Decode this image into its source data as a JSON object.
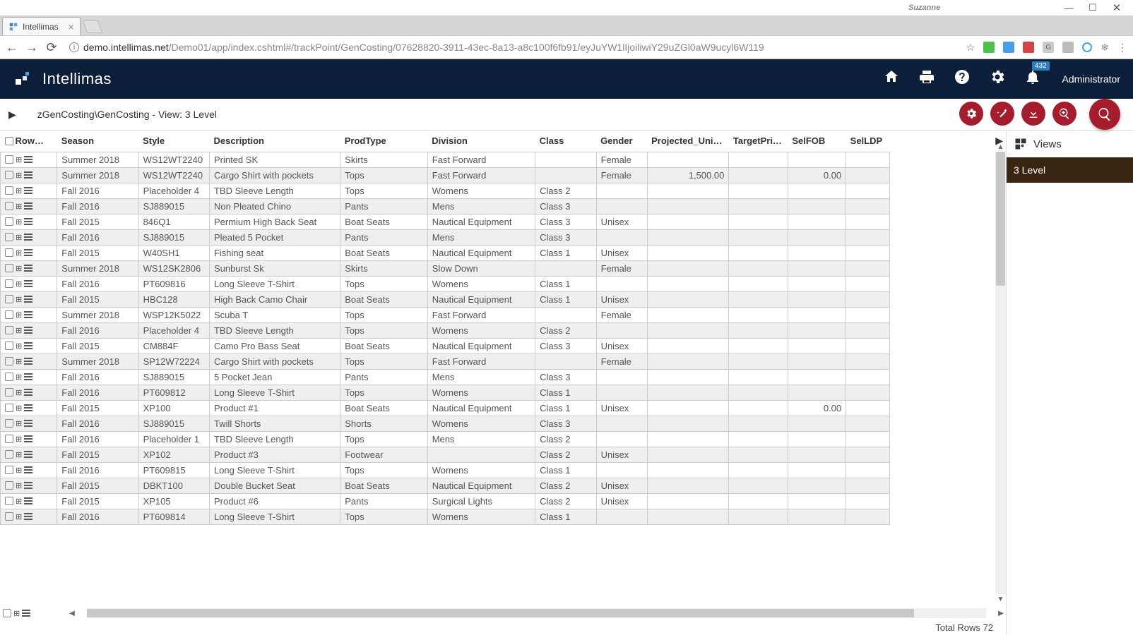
{
  "window": {
    "user": "Suzanne",
    "tab_title": "Intellimas",
    "url_host": "demo.intellimas.net",
    "url_path": "/Demo01/app/index.cshtml#/trackPoint/GenCosting/07628820-3911-43ec-8a13-a8c100f6fb91/eyJuYW1lIjoiliwiY29uZGl0aW9ucyl6W119"
  },
  "header": {
    "brand": "Intellimas",
    "notification_count": "432",
    "user_role": "Administrator"
  },
  "breadcrumb": {
    "text": "zGenCosting\\GenCosting - View: 3 Level"
  },
  "views_panel": {
    "title": "Views",
    "items": [
      "3 Level"
    ]
  },
  "grid": {
    "footer": "Total Rows 72",
    "columns": {
      "row": "Row…",
      "season": "Season",
      "style": "Style",
      "description": "Description",
      "prodtype": "ProdType",
      "division": "Division",
      "class": "Class",
      "gender": "Gender",
      "projected": "Projected_Uni…",
      "target": "TargetPri…",
      "selfob": "SelFOB",
      "selldp": "SelLDP"
    },
    "rows": [
      {
        "season": "Summer 2018",
        "style": "WS12WT2240",
        "description": "Printed SK",
        "prodtype": "Skirts",
        "division": "Fast Forward",
        "class": "",
        "gender": "Female",
        "projected": "",
        "target": "",
        "selfob": "",
        "selldp": ""
      },
      {
        "season": "Summer 2018",
        "style": "WS12WT2240",
        "description": "Cargo Shirt with pockets",
        "prodtype": "Tops",
        "division": "Fast Forward",
        "class": "",
        "gender": "Female",
        "projected": "1,500.00",
        "target": "",
        "selfob": "0.00",
        "selldp": ""
      },
      {
        "season": "Fall 2016",
        "style": "Placeholder 4",
        "description": "TBD Sleeve Length",
        "prodtype": "Tops",
        "division": "Womens",
        "class": "Class 2",
        "gender": "",
        "projected": "",
        "target": "",
        "selfob": "",
        "selldp": ""
      },
      {
        "season": "Fall 2016",
        "style": "SJ889015",
        "description": "Non Pleated Chino",
        "prodtype": "Pants",
        "division": "Mens",
        "class": "Class 3",
        "gender": "",
        "projected": "",
        "target": "",
        "selfob": "",
        "selldp": ""
      },
      {
        "season": "Fall 2015",
        "style": "846Q1",
        "description": "Permium High Back Seat",
        "prodtype": "Boat Seats",
        "division": "Nautical Equipment",
        "class": "Class 3",
        "gender": "Unisex",
        "projected": "",
        "target": "",
        "selfob": "",
        "selldp": ""
      },
      {
        "season": "Fall 2016",
        "style": "SJ889015",
        "description": "Pleated 5 Pocket",
        "prodtype": "Pants",
        "division": "Mens",
        "class": "Class 3",
        "gender": "",
        "projected": "",
        "target": "",
        "selfob": "",
        "selldp": ""
      },
      {
        "season": "Fall 2015",
        "style": "W40SH1",
        "description": "Fishing seat",
        "prodtype": "Boat Seats",
        "division": "Nautical Equipment",
        "class": "Class 1",
        "gender": "Unisex",
        "projected": "",
        "target": "",
        "selfob": "",
        "selldp": ""
      },
      {
        "season": "Summer 2018",
        "style": "WS12SK2806",
        "description": "Sunburst Sk",
        "prodtype": "Skirts",
        "division": "Slow Down",
        "class": "",
        "gender": "Female",
        "projected": "",
        "target": "",
        "selfob": "",
        "selldp": ""
      },
      {
        "season": "Fall 2016",
        "style": "PT609816",
        "description": "Long Sleeve T-Shirt",
        "prodtype": "Tops",
        "division": "Womens",
        "class": "Class 1",
        "gender": "",
        "projected": "",
        "target": "",
        "selfob": "",
        "selldp": ""
      },
      {
        "season": "Fall 2015",
        "style": "HBC128",
        "description": "High Back Camo Chair",
        "prodtype": "Boat Seats",
        "division": "Nautical Equipment",
        "class": "Class 1",
        "gender": "Unisex",
        "projected": "",
        "target": "",
        "selfob": "",
        "selldp": ""
      },
      {
        "season": "Summer 2018",
        "style": "WSP12K5022",
        "description": "Scuba T",
        "prodtype": "Tops",
        "division": "Fast Forward",
        "class": "",
        "gender": "Female",
        "projected": "",
        "target": "",
        "selfob": "",
        "selldp": ""
      },
      {
        "season": "Fall 2016",
        "style": "Placeholder 4",
        "description": "TBD Sleeve Length",
        "prodtype": "Tops",
        "division": "Womens",
        "class": "Class 2",
        "gender": "",
        "projected": "",
        "target": "",
        "selfob": "",
        "selldp": ""
      },
      {
        "season": "Fall 2015",
        "style": "CM884F",
        "description": "Camo Pro Bass Seat",
        "prodtype": "Boat Seats",
        "division": "Nautical Equipment",
        "class": "Class 3",
        "gender": "Unisex",
        "projected": "",
        "target": "",
        "selfob": "",
        "selldp": ""
      },
      {
        "season": "Summer 2018",
        "style": "SP12W72224",
        "description": "Cargo Shirt with pockets",
        "prodtype": "Tops",
        "division": "Fast Forward",
        "class": "",
        "gender": "Female",
        "projected": "",
        "target": "",
        "selfob": "",
        "selldp": ""
      },
      {
        "season": "Fall 2016",
        "style": "SJ889015",
        "description": "5 Pocket Jean",
        "prodtype": "Pants",
        "division": "Mens",
        "class": "Class 3",
        "gender": "",
        "projected": "",
        "target": "",
        "selfob": "",
        "selldp": ""
      },
      {
        "season": "Fall 2016",
        "style": "PT609812",
        "description": "Long Sleeve T-Shirt",
        "prodtype": "Tops",
        "division": "Womens",
        "class": "Class 1",
        "gender": "",
        "projected": "",
        "target": "",
        "selfob": "",
        "selldp": ""
      },
      {
        "season": "Fall 2015",
        "style": "XP100",
        "description": "Product #1",
        "prodtype": "Boat Seats",
        "division": "Nautical Equipment",
        "class": "Class 1",
        "gender": "Unisex",
        "projected": "",
        "target": "",
        "selfob": "0.00",
        "selldp": ""
      },
      {
        "season": "Fall 2016",
        "style": "SJ889015",
        "description": "Twill Shorts",
        "prodtype": "Shorts",
        "division": "Womens",
        "class": "Class 3",
        "gender": "",
        "projected": "",
        "target": "",
        "selfob": "",
        "selldp": ""
      },
      {
        "season": "Fall 2016",
        "style": "Placeholder 1",
        "description": "TBD Sleeve Length",
        "prodtype": "Tops",
        "division": "Mens",
        "class": "Class 2",
        "gender": "",
        "projected": "",
        "target": "",
        "selfob": "",
        "selldp": ""
      },
      {
        "season": "Fall 2015",
        "style": "XP102",
        "description": "Product #3",
        "prodtype": "Footwear",
        "division": "",
        "class": "Class 2",
        "gender": "Unisex",
        "projected": "",
        "target": "",
        "selfob": "",
        "selldp": ""
      },
      {
        "season": "Fall 2016",
        "style": "PT609815",
        "description": "Long Sleeve T-Shirt",
        "prodtype": "Tops",
        "division": "Womens",
        "class": "Class 1",
        "gender": "",
        "projected": "",
        "target": "",
        "selfob": "",
        "selldp": ""
      },
      {
        "season": "Fall 2015",
        "style": "DBKT100",
        "description": "Double Bucket Seat",
        "prodtype": "Boat Seats",
        "division": "Nautical Equipment",
        "class": "Class 2",
        "gender": "Unisex",
        "projected": "",
        "target": "",
        "selfob": "",
        "selldp": ""
      },
      {
        "season": "Fall 2015",
        "style": "XP105",
        "description": "Product #6",
        "prodtype": "Pants",
        "division": "Surgical Lights",
        "class": "Class 2",
        "gender": "Unisex",
        "projected": "",
        "target": "",
        "selfob": "",
        "selldp": ""
      },
      {
        "season": "Fall 2016",
        "style": "PT609814",
        "description": "Long Sleeve T-Shirt",
        "prodtype": "Tops",
        "division": "Womens",
        "class": "Class 1",
        "gender": "",
        "projected": "",
        "target": "",
        "selfob": "",
        "selldp": ""
      }
    ]
  }
}
